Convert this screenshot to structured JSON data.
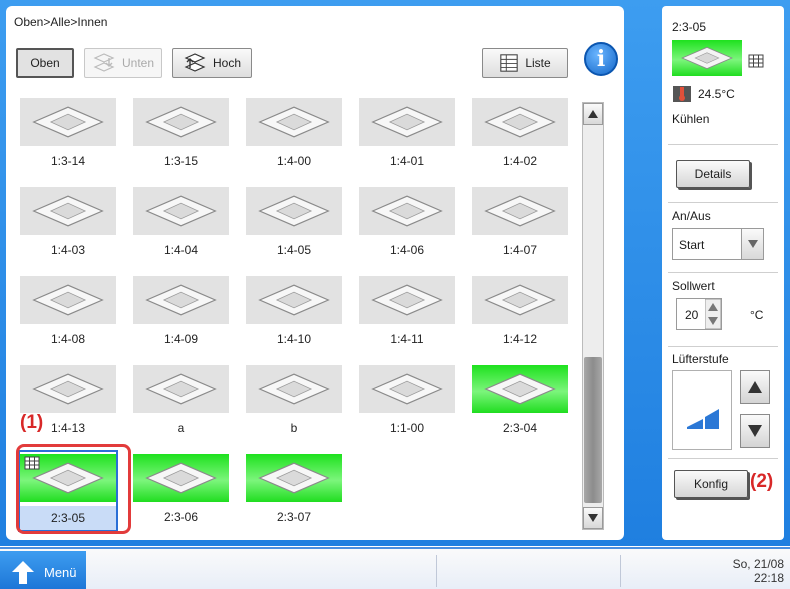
{
  "breadcrumb": "Oben>Alle>Innen",
  "toolbar": {
    "oben": "Oben",
    "unten": "Unten",
    "hoch": "Hoch",
    "liste": "Liste",
    "info": "i"
  },
  "units": [
    {
      "label": "1:3-14",
      "state": "off"
    },
    {
      "label": "1:3-15",
      "state": "off"
    },
    {
      "label": "1:4-00",
      "state": "off"
    },
    {
      "label": "1:4-01",
      "state": "off"
    },
    {
      "label": "1:4-02",
      "state": "off"
    },
    {
      "label": "1:4-03",
      "state": "off"
    },
    {
      "label": "1:4-04",
      "state": "off"
    },
    {
      "label": "1:4-05",
      "state": "off"
    },
    {
      "label": "1:4-06",
      "state": "off"
    },
    {
      "label": "1:4-07",
      "state": "off"
    },
    {
      "label": "1:4-08",
      "state": "off"
    },
    {
      "label": "1:4-09",
      "state": "off"
    },
    {
      "label": "1:4-10",
      "state": "off"
    },
    {
      "label": "1:4-11",
      "state": "off"
    },
    {
      "label": "1:4-12",
      "state": "off"
    },
    {
      "label": "1:4-13",
      "state": "off"
    },
    {
      "label": "a",
      "state": "off"
    },
    {
      "label": "b",
      "state": "off"
    },
    {
      "label": "1:1-00",
      "state": "off"
    },
    {
      "label": "2:3-04",
      "state": "on"
    },
    {
      "label": "2:3-05",
      "state": "on",
      "selected": true
    },
    {
      "label": "2:3-06",
      "state": "on"
    },
    {
      "label": "2:3-07",
      "state": "on"
    }
  ],
  "callouts": {
    "one": "(1)",
    "two": "(2)"
  },
  "details": {
    "name": "2:3-05",
    "temperature": "24.5°C",
    "mode": "Kühlen",
    "details_button": "Details",
    "onoff_label": "An/Aus",
    "onoff_value": "Start",
    "setpoint_label": "Sollwert",
    "setpoint_value": "20",
    "setpoint_unit": "°C",
    "fan_label": "Lüfterstufe",
    "config_button": "Konfig"
  },
  "bottom": {
    "menu": "Menü",
    "date": "So, 21/08",
    "time": "22:18"
  },
  "colors": {
    "accent": "#1f7fe0",
    "unit_on": "#22e022",
    "unit_off": "#e2e2e2",
    "highlight": "#e23b3b"
  }
}
